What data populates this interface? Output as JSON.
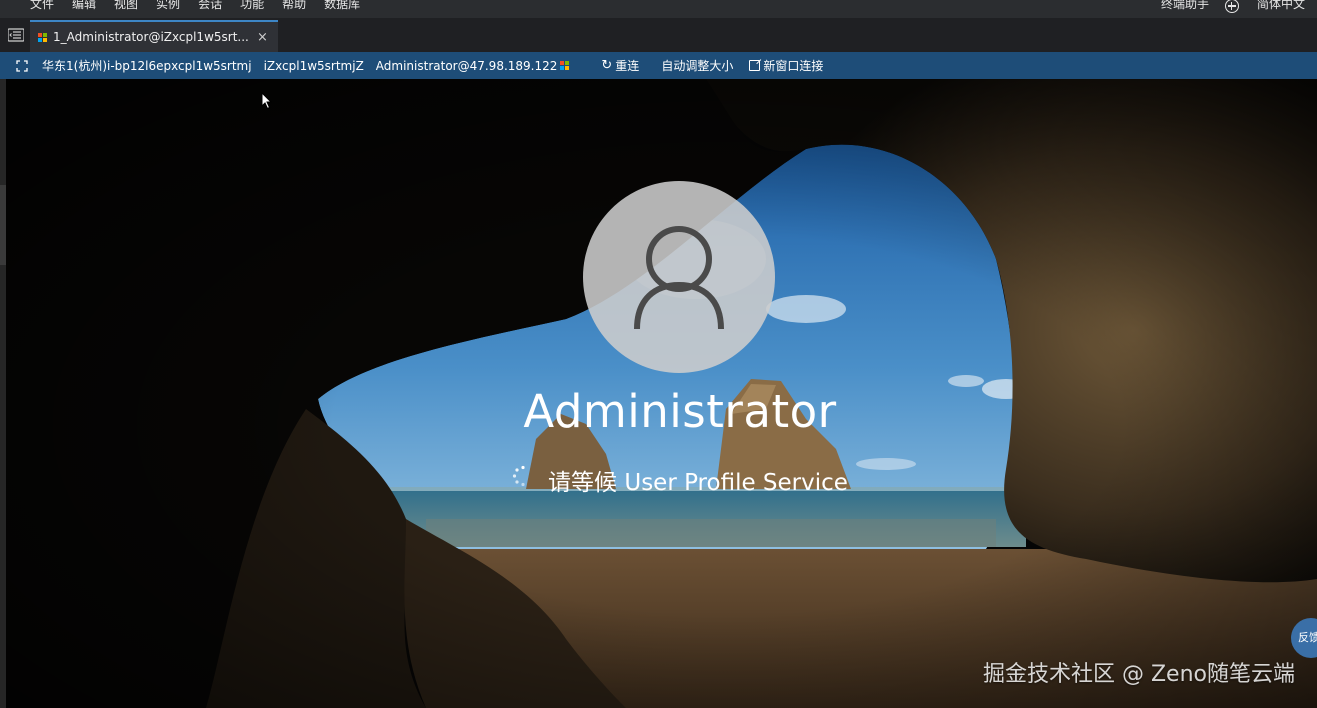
{
  "menubar": {
    "items": [
      "文件",
      "编辑",
      "视图",
      "实例",
      "会话",
      "功能",
      "帮助",
      "数据库"
    ],
    "assistant": "终端助手",
    "language": "简体中文"
  },
  "tab": {
    "title": "1_Administrator@iZxcpl1w5srt...",
    "close_glyph": "×"
  },
  "connection": {
    "region_instance": "华东1(杭州)i-bp12l6epxcpl1w5srtmj",
    "hostname": "iZxcpl1w5srtmjZ",
    "user_at_ip": "Administrator@47.98.189.122",
    "reconnect_icon": "↻",
    "reconnect_label": "重连",
    "autosize_label": "自动调整大小",
    "new_window_label": "新窗口连接"
  },
  "login_screen": {
    "username": "Administrator",
    "status": "请等候 User Profile Service"
  },
  "watermark": "掘金技术社区 @ Zeno随笔云端",
  "feedback_label": "反馈",
  "colors": {
    "menubar_bg": "#2b2d30",
    "tab_bg": "#2f3136",
    "tab_accent": "#3d86c6",
    "connbar_bg": "#1e4d78"
  }
}
